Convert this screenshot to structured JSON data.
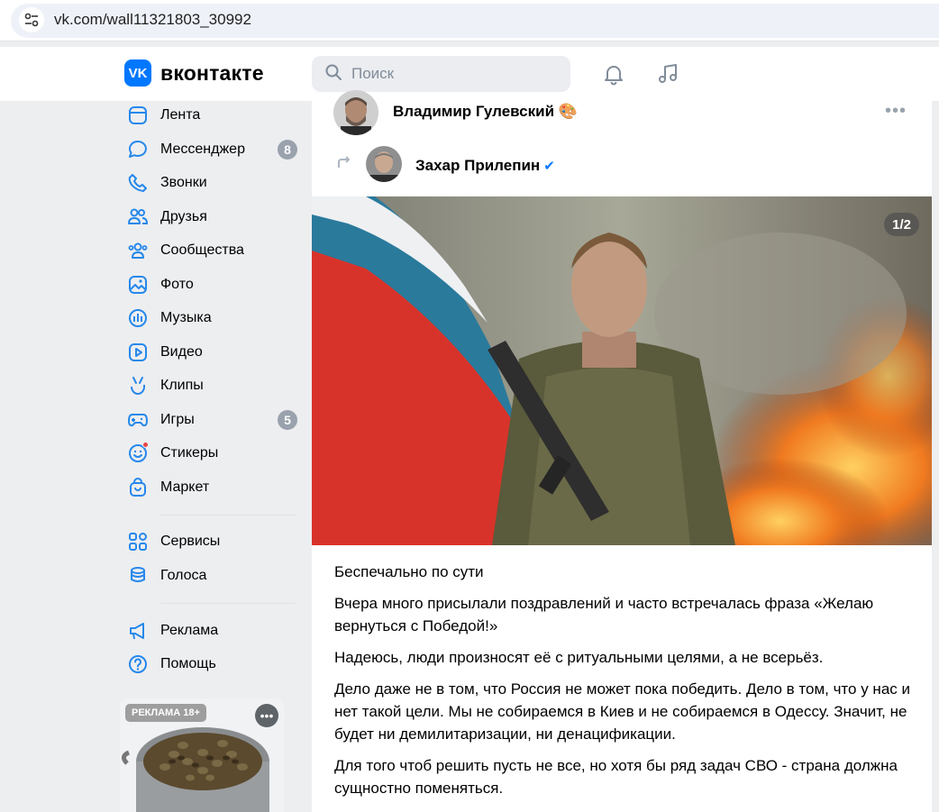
{
  "browser": {
    "url": "vk.com/wall11321803_30992",
    "icons": {
      "site": "tune-icon"
    }
  },
  "header": {
    "logo_mark": "VK",
    "logo_text": "вконтакте",
    "search_placeholder": "Поиск",
    "icons": [
      "search-icon",
      "bell-icon",
      "music-note-icon"
    ],
    "accent_color": "#0077ff"
  },
  "sidebar": {
    "items": [
      {
        "label": "Лента",
        "icon": "feed-icon"
      },
      {
        "label": "Мессенджер",
        "icon": "chat-bubble-icon",
        "badge": "8"
      },
      {
        "label": "Звонки",
        "icon": "phone-icon"
      },
      {
        "label": "Друзья",
        "icon": "friends-icon"
      },
      {
        "label": "Сообщества",
        "icon": "communities-icon"
      },
      {
        "label": "Фото",
        "icon": "photo-icon"
      },
      {
        "label": "Музыка",
        "icon": "music-bars-icon"
      },
      {
        "label": "Видео",
        "icon": "video-icon"
      },
      {
        "label": "Клипы",
        "icon": "clips-icon"
      },
      {
        "label": "Игры",
        "icon": "gamepad-icon",
        "badge": "5"
      },
      {
        "label": "Стикеры",
        "icon": "sticker-smile-icon"
      },
      {
        "label": "Маркет",
        "icon": "shopping-bag-icon"
      }
    ],
    "secondary": [
      {
        "label": "Сервисы",
        "icon": "services-grid-icon"
      },
      {
        "label": "Голоса",
        "icon": "coins-stack-icon"
      }
    ],
    "tertiary": [
      {
        "label": "Реклама",
        "icon": "megaphone-icon"
      },
      {
        "label": "Помощь",
        "icon": "help-circle-icon"
      }
    ],
    "ad": {
      "label": "РЕКЛАМА 18+",
      "more_icon": "more-dots-icon"
    }
  },
  "post": {
    "author": "Владимир Гулевский",
    "author_emoji": "🎨",
    "more_icon": "more-horizontal-icon",
    "repost_icon": "repost-arrow-icon",
    "repost_author": "Захар Прилепин",
    "verified_mark": "✔",
    "photo_counter": "1/2",
    "paragraphs": [
      "Беспечально по сути",
      "Вчера много присылали поздравлений и часто встречалась фраза «Желаю вернуться с Победой!»",
      "Надеюсь, люди произносят её с ритуальными целями, а не всерьёз.",
      "Дело даже не в том, что Россия не может пока победить. Дело в том, что у нас и нет такой цели. Мы не собираемся в Киев и не собираемся в Одессу. Значит, не будет ни демилитаризации, ни денацификации.",
      "Для того чтоб решить пусть не все, но хотя бы ряд задач СВО - страна должна сущностно поменяться."
    ]
  }
}
